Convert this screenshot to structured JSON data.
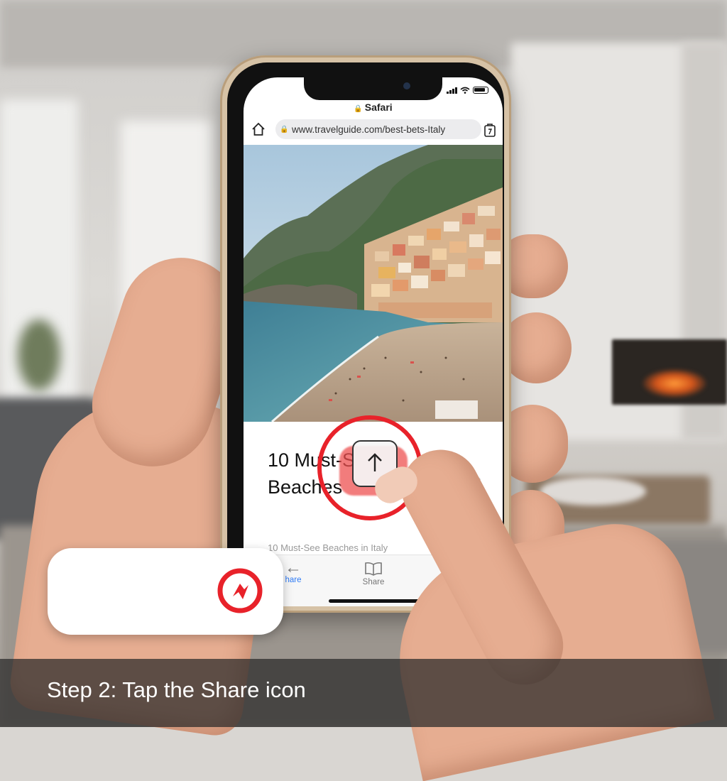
{
  "browser": {
    "title": "Safari",
    "url": "www.travelguide.com/best-bets-Italy",
    "home_icon": "home-icon",
    "tabs_icon": "tabs-icon"
  },
  "article": {
    "headline_line1": "10 Must-S",
    "headline_line2": "Beaches",
    "caption": "10 Must-See Beaches in Italy"
  },
  "toolbar": {
    "back_label": "hare",
    "share_label": "Share"
  },
  "instruction": "Step 2: Tap the Share icon",
  "colors": {
    "highlight": "#e8222a",
    "link": "#2f7cf6"
  }
}
